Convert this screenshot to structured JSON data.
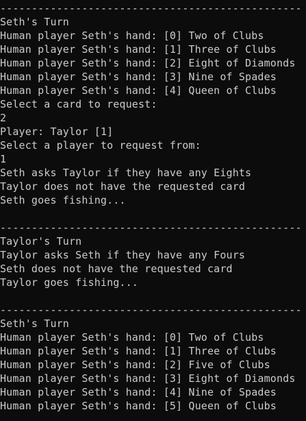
{
  "console": {
    "lines": [
      "------------------------------------------------",
      "Seth's Turn",
      "Human player Seth's hand: [0] Two of Clubs",
      "Human player Seth's hand: [1] Three of Clubs",
      "Human player Seth's hand: [2] Eight of Diamonds",
      "Human player Seth's hand: [3] Nine of Spades",
      "Human player Seth's hand: [4] Queen of Clubs",
      "Select a card to request:",
      "2",
      "Player: Taylor [1]",
      "Select a player to request from:",
      "1",
      "Seth asks Taylor if they have any Eights",
      "Taylor does not have the requested card",
      "Seth goes fishing...",
      "",
      "------------------------------------------------",
      "Taylor's Turn",
      "Taylor asks Seth if they have any Fours",
      "Seth does not have the requested card",
      "Taylor goes fishing...",
      "",
      "------------------------------------------------",
      "Seth's Turn",
      "Human player Seth's hand: [0] Two of Clubs",
      "Human player Seth's hand: [1] Three of Clubs",
      "Human player Seth's hand: [2] Five of Clubs",
      "Human player Seth's hand: [3] Eight of Diamonds",
      "Human player Seth's hand: [4] Nine of Spades",
      "Human player Seth's hand: [5] Queen of Clubs"
    ]
  }
}
